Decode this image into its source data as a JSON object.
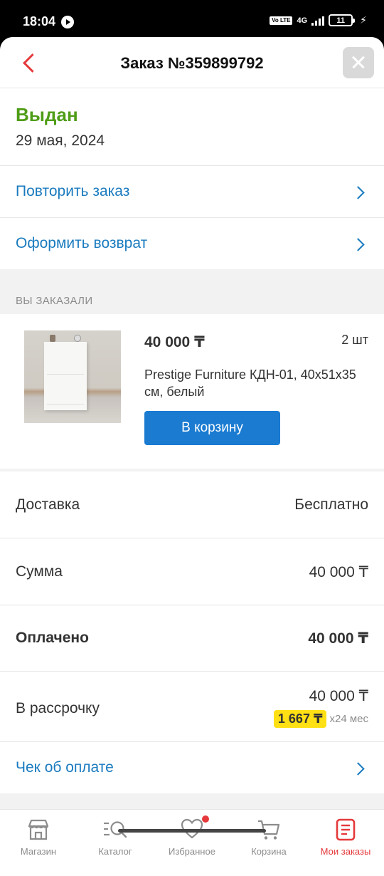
{
  "status_bar": {
    "time": "18:04",
    "volte": "Vo LTE",
    "network": "4G",
    "battery": "11"
  },
  "header": {
    "title": "Заказ №359899792"
  },
  "order": {
    "status": "Выдан",
    "date": "29 мая, 2024",
    "status_color": "#4f9d17"
  },
  "actions": [
    {
      "label": "Повторить заказ"
    },
    {
      "label": "Оформить возврат"
    }
  ],
  "ordered_section": {
    "title": "ВЫ ЗАКАЗАЛИ",
    "product": {
      "price": "40 000 ₸",
      "quantity": "2 шт",
      "name": "Prestige Furniture КДН-01, 40x51x35 см, белый",
      "cart_button": "В корзину"
    }
  },
  "summary": {
    "delivery": {
      "label": "Доставка",
      "value": "Бесплатно"
    },
    "sum": {
      "label": "Сумма",
      "value": "40 000 ₸"
    },
    "paid": {
      "label": "Оплачено",
      "value": "40 000 ₸"
    },
    "installment": {
      "label": "В рассрочку",
      "value": "40 000 ₸",
      "monthly": "1 667 ₸",
      "term": "x24 мес"
    }
  },
  "receipt": {
    "label": "Чек об оплате"
  },
  "bottom_nav": [
    {
      "label": "Магазин",
      "icon": "shop-icon"
    },
    {
      "label": "Каталог",
      "icon": "catalog-search-icon"
    },
    {
      "label": "Избранное",
      "icon": "heart-icon"
    },
    {
      "label": "Корзина",
      "icon": "cart-icon"
    },
    {
      "label": "Мои заказы",
      "icon": "orders-icon",
      "active": true
    }
  ],
  "colors": {
    "accent_red": "#e5393b",
    "link_blue": "#1a7bbf",
    "button_blue": "#1a7bd1",
    "badge_yellow": "#ffe014"
  }
}
